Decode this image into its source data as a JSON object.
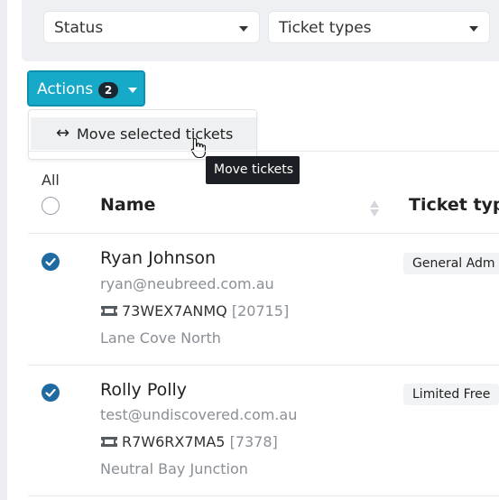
{
  "filters": {
    "status_label": "Status",
    "ticket_types_label": "Ticket types"
  },
  "actions": {
    "label": "Actions",
    "count": "2"
  },
  "dropdown": {
    "move_label": "Move selected tickets"
  },
  "tooltip": {
    "text": "Move tickets"
  },
  "table": {
    "select_all_label": "All",
    "columns": {
      "name": "Name",
      "ticket_type": "Ticket typ"
    },
    "rows": [
      {
        "name": "Ryan Johnson",
        "email": "ryan@neubreed.com.au",
        "ticket_code": "73WEX7ANMQ",
        "ticket_id": "[20715]",
        "location": "Lane Cove North",
        "ticket_type": "General Adm",
        "selected": true
      },
      {
        "name": "Rolly Polly",
        "email": "test@undiscovered.com.au",
        "ticket_code": "R7W6RX7MA5",
        "ticket_id": "[7378]",
        "location": "Neutral Bay Junction",
        "ticket_type": "Limited Free",
        "selected": true
      }
    ]
  },
  "colors": {
    "accent": "#17aac8",
    "check": "#1f6aa0",
    "tooltip_bg": "#1c1f24"
  },
  "icons": [
    "chevron-down-icon",
    "arrows-horizontal-icon",
    "hand-pointer-icon",
    "sort-icon",
    "checkmark-icon",
    "ticket-icon"
  ]
}
